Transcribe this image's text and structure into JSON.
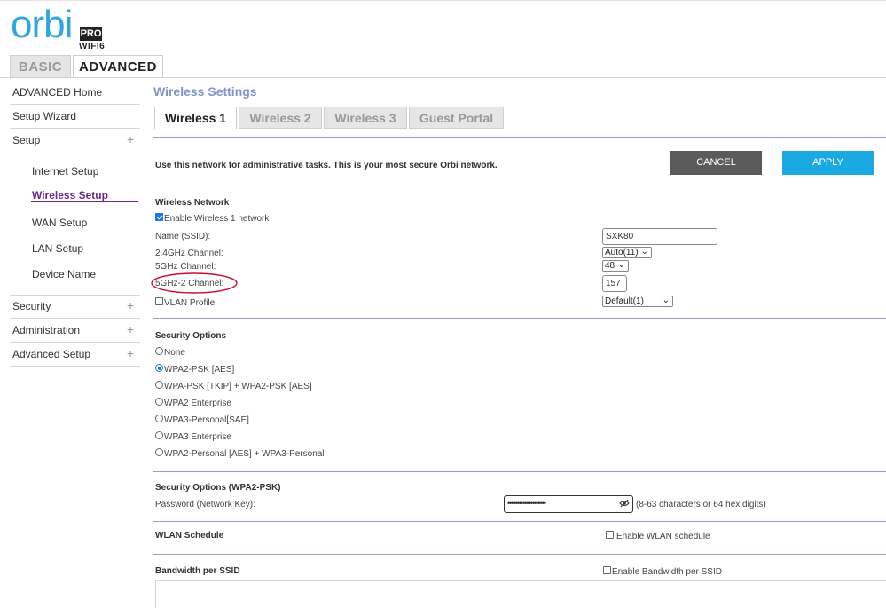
{
  "logo": {
    "word": "orbi",
    "badge": "PRO",
    "sub": "WIFI6"
  },
  "top_tabs": {
    "basic": "BASIC",
    "advanced": "ADVANCED"
  },
  "sidebar": {
    "advanced_home": "ADVANCED Home",
    "setup_wizard": "Setup Wizard",
    "setup": "Setup",
    "setup_sub": {
      "internet": "Internet Setup",
      "wireless": "Wireless Setup",
      "wan": "WAN Setup",
      "lan": "LAN Setup",
      "device_name": "Device Name"
    },
    "security": "Security",
    "administration": "Administration",
    "advanced_setup": "Advanced Setup",
    "plus": "+"
  },
  "main": {
    "title": "Wireless Settings",
    "tabs": {
      "w1": "Wireless 1",
      "w2": "Wireless 2",
      "w3": "Wireless 3",
      "guest": "Guest Portal"
    },
    "intro": "Use this network for administrative tasks. This is your most secure Orbi network.",
    "cancel": "CANCEL",
    "apply": "APPLY"
  },
  "wireless_network": {
    "heading": "Wireless Network",
    "enable_label": "Enable Wireless 1 network",
    "enable_checked": true,
    "ssid_label": "Name (SSID):",
    "ssid_value": "SXK80",
    "ch24_label": "2.4GHz Channel:",
    "ch24_value": "Auto(11)",
    "ch5_label": "5GHz Channel:",
    "ch5_value": "48",
    "ch52_label": "5GHz-2 Channel:",
    "ch52_value": "157",
    "vlan_label": "VLAN Profile",
    "vlan_checked": false,
    "vlan_value": "Default(1)"
  },
  "security_options": {
    "heading": "Security Options",
    "selected": "WPA2-PSK [AES]",
    "options": [
      "None",
      "WPA2-PSK [AES]",
      "WPA-PSK [TKIP] + WPA2-PSK [AES]",
      "WPA2 Enterprise",
      "WPA3-Personal[SAE]",
      "WPA3 Enterprise",
      "WPA2-Personal [AES] + WPA3-Personal"
    ]
  },
  "psk": {
    "heading": "Security Options (WPA2-PSK)",
    "password_label": "Password (Network Key):",
    "password_masked": "••••••••••••••••••••",
    "hint": "(8-63 characters or 64 hex digits)"
  },
  "wlan_schedule": {
    "heading": "WLAN Schedule",
    "enable_label": "Enable WLAN schedule",
    "checked": false
  },
  "bandwidth": {
    "heading": "Bandwidth per SSID",
    "enable_label": "Enable Bandwidth per SSID",
    "checked": false
  },
  "colors": {
    "accent": "#2ea6e2",
    "apply": "#1ba9e1",
    "cancel": "#5b5b5b",
    "active_nav": "#6a2a8c",
    "title": "#7f95c8",
    "annotation": "#c8102e"
  },
  "icons": {
    "eye": "eye-slash-icon"
  }
}
